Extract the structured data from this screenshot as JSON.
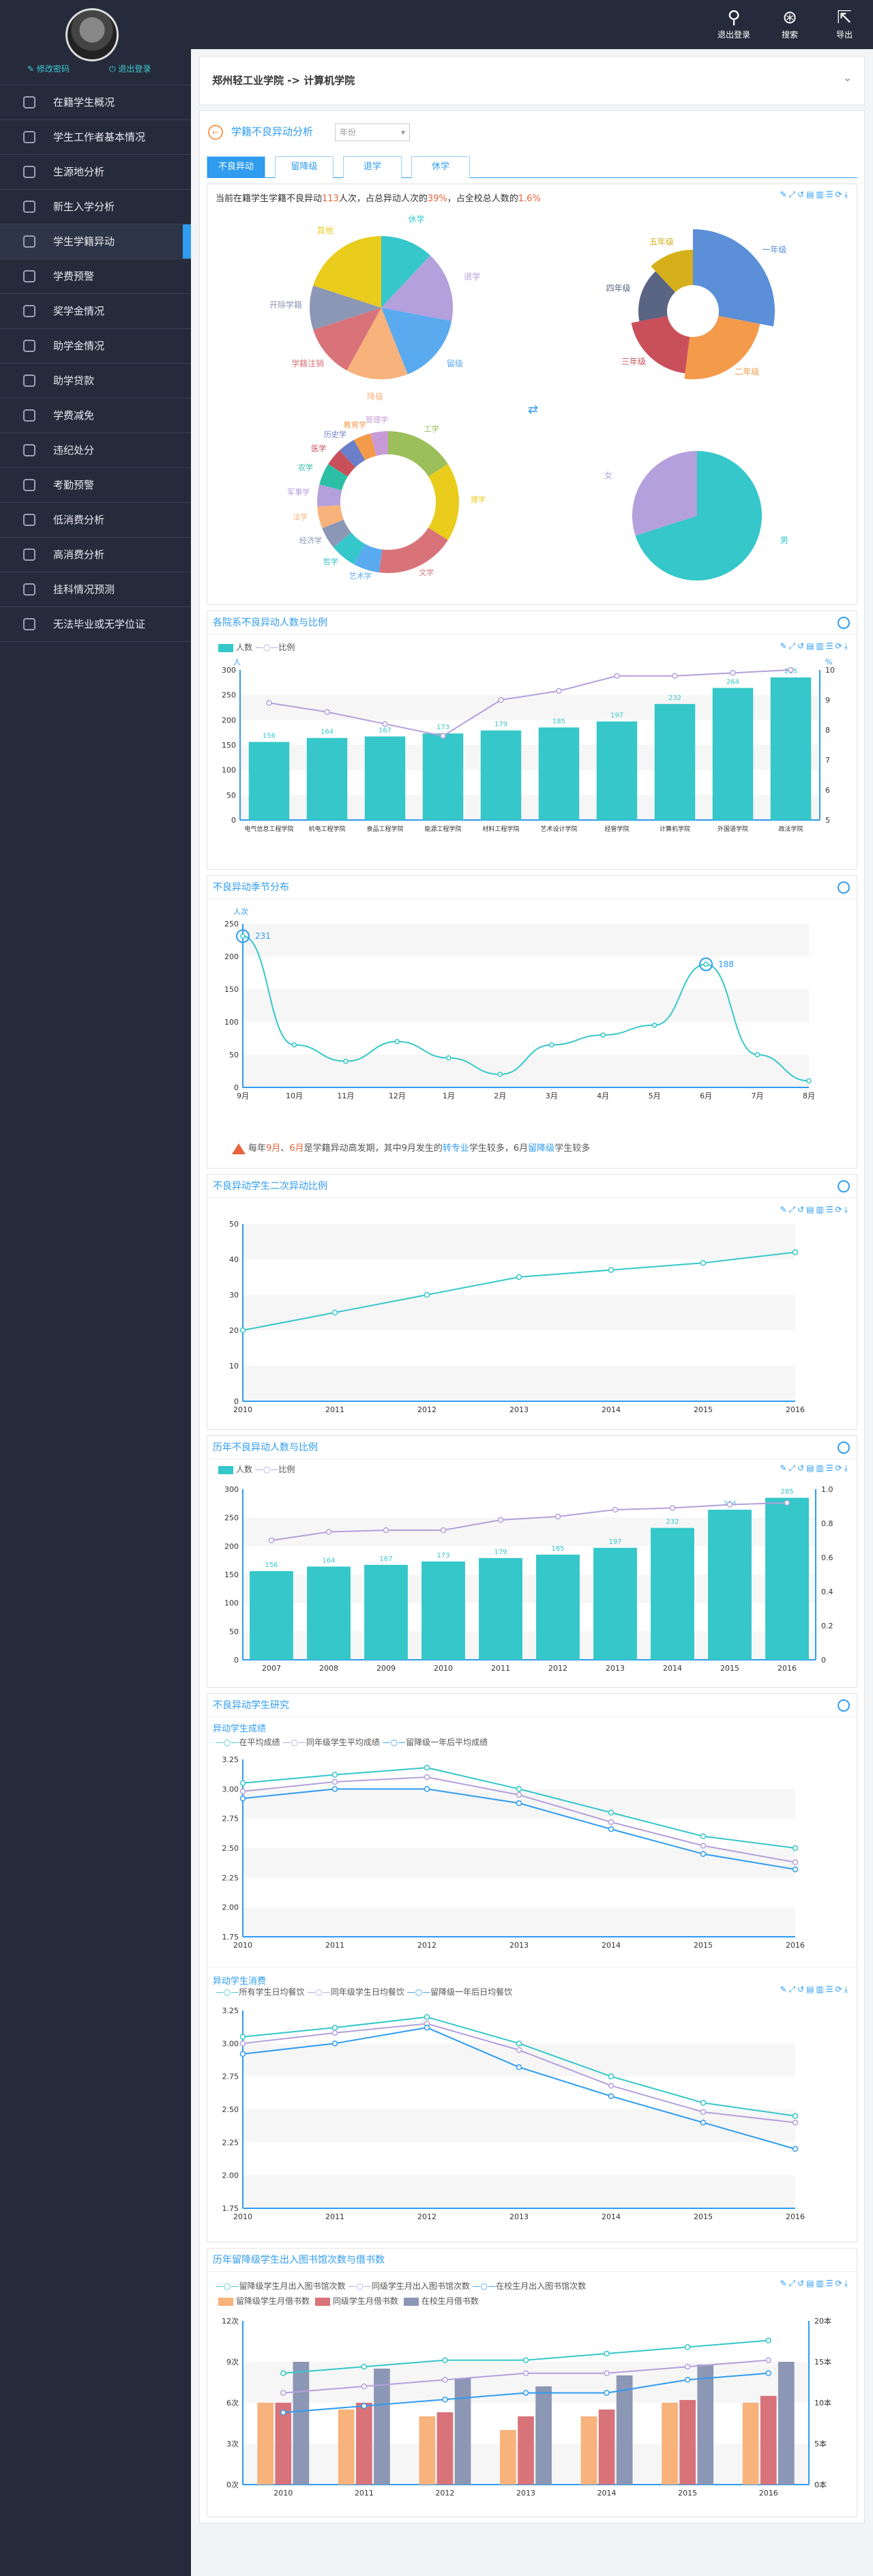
{
  "header": {
    "btn_logout": "退出登录",
    "btn_search": "搜索",
    "btn_export": "导出"
  },
  "sidebar": {
    "profile_edit": "修改密码",
    "profile_logout": "退出登录",
    "items": [
      {
        "label": "在籍学生概况"
      },
      {
        "label": "学生工作者基本情况"
      },
      {
        "label": "生源地分析"
      },
      {
        "label": "新生入学分析"
      },
      {
        "label": "学生学籍异动"
      },
      {
        "label": "学费预警"
      },
      {
        "label": "奖学金情况"
      },
      {
        "label": "助学金情况"
      },
      {
        "label": "助学贷款"
      },
      {
        "label": "学费减免"
      },
      {
        "label": "违纪处分"
      },
      {
        "label": "考勤预警"
      },
      {
        "label": "低消费分析"
      },
      {
        "label": "高消费分析"
      },
      {
        "label": "挂科情况预测"
      },
      {
        "label": "无法毕业或无学位证"
      }
    ],
    "active_index": 4
  },
  "breadcrumb": {
    "root": "郑州轻工业学院",
    "sep": "->",
    "current": "计算机学院"
  },
  "page": {
    "title": "学籍不良异动分析",
    "select_placeholder": "年份",
    "tabs": [
      "不良异动",
      "留降级",
      "退学",
      "休学"
    ],
    "summary_pre": "当前在籍学生学籍不良异动",
    "summary_n": "113",
    "summary_mid": "人次，占总异动人次的",
    "summary_p1": "39%",
    "summary_mid2": "，占全校总人数的",
    "summary_p2": "1.6%"
  },
  "colors": {
    "teal": "#35c7c9",
    "purple": "#b3a0dc",
    "blue": "#2f9cf0",
    "orange": "#e8643c"
  },
  "pies": {
    "pie1": {
      "labels": [
        "休学",
        "退学",
        "留级",
        "降级",
        "学籍注销",
        "开除学籍",
        "其他"
      ]
    },
    "pie2": {
      "labels": [
        "一年级",
        "二年级",
        "三年级",
        "四年级",
        "五年级"
      ]
    },
    "pie3": {
      "labels": [
        "工学",
        "理学",
        "文学",
        "艺术学",
        "哲学",
        "经济学",
        "法学",
        "军事学",
        "农学",
        "医学",
        "历史学",
        "教育学",
        "管理学"
      ]
    },
    "pie4": {
      "labels": [
        "男",
        "女"
      ]
    }
  },
  "sections": {
    "s1": "各院系不良异动人数与比例",
    "s2": "不良异动季节分布",
    "s3": "不良异动学生二次异动比例",
    "s4": "历年不良异动人数与比例",
    "s5": "不良异动学生研究",
    "s5a": "异动学生成绩",
    "s5b": "异动学生消费",
    "s6": "历年留降级学生出入图书馆次数与借书数"
  },
  "warning": {
    "pre": "每年",
    "m1": "9月",
    "sep": "、",
    "m2": "6月",
    "mid": "是学籍异动高发期，其中9月发生的",
    "t1": "转专业",
    "mid2": "学生较多，6月",
    "t2": "留降级",
    "post": "学生较多"
  },
  "chart_data": [
    {
      "type": "bar",
      "title": "各院系不良异动人数与比例",
      "series": [
        {
          "name": "人数",
          "values": [
            156,
            164,
            167,
            173,
            179,
            185,
            197,
            232,
            264,
            285
          ]
        },
        {
          "name": "比例",
          "values": [
            8.9,
            8.6,
            8.2,
            7.8,
            9.0,
            9.3,
            9.8,
            9.8,
            9.9,
            10
          ]
        }
      ],
      "categories": [
        "电气信息工程学院",
        "机电工程学院",
        "食品工程学院",
        "能源工程学院",
        "材料工程学院",
        "艺术设计学院",
        "经管学院",
        "计算机学院",
        "外国语学院",
        "政法学院"
      ],
      "ylabel": "人",
      "ylabel_right": "%",
      "ylim": [
        0,
        300
      ],
      "ylim_right": [
        5,
        10
      ],
      "yticks_right": [
        "5",
        "6",
        "7",
        "8",
        "9",
        "10"
      ]
    },
    {
      "type": "line",
      "title": "不良异动季节分布",
      "categories": [
        "9月",
        "10月",
        "11月",
        "12月",
        "1月",
        "2月",
        "3月",
        "4月",
        "5月",
        "6月",
        "7月",
        "8月"
      ],
      "values": [
        231,
        65,
        40,
        70,
        45,
        20,
        65,
        80,
        95,
        188,
        50,
        10
      ],
      "annotations": [
        "231",
        "188"
      ],
      "ylabel": "人次",
      "ylim": [
        0,
        250
      ]
    },
    {
      "type": "line",
      "title": "不良异动学生二次异动比例",
      "categories": [
        "2010",
        "2011",
        "2012",
        "2013",
        "2014",
        "2015",
        "2016"
      ],
      "values": [
        20,
        25,
        30,
        35,
        37,
        39,
        42
      ],
      "ylim": [
        0,
        50
      ]
    },
    {
      "type": "bar",
      "title": "历年不良异动人数与比例",
      "categories": [
        "2007",
        "2008",
        "2009",
        "2010",
        "2011",
        "2012",
        "2013",
        "2014",
        "2015",
        "2016"
      ],
      "series": [
        {
          "name": "人数",
          "values": [
            156,
            164,
            167,
            173,
            179,
            185,
            197,
            232,
            264,
            285
          ]
        },
        {
          "name": "比例",
          "values": [
            0.7,
            0.75,
            0.76,
            0.76,
            0.82,
            0.84,
            0.88,
            0.89,
            0.91,
            0.92
          ]
        }
      ],
      "ylim": [
        0,
        300
      ],
      "ylim_right": [
        0,
        1.0
      ],
      "yticks_right": [
        "0",
        "0.2",
        "0.4",
        "0.6",
        "0.8",
        "1.0"
      ]
    },
    {
      "type": "line",
      "title": "异动学生成绩",
      "categories": [
        "2010",
        "2011",
        "2012",
        "2013",
        "2014",
        "2015",
        "2016"
      ],
      "series": [
        {
          "name": "在平均成绩",
          "values": [
            3.05,
            3.12,
            3.18,
            3.0,
            2.8,
            2.6,
            2.5
          ]
        },
        {
          "name": "同年级学生平均成绩",
          "values": [
            2.98,
            3.06,
            3.1,
            2.95,
            2.72,
            2.52,
            2.38
          ]
        },
        {
          "name": "留降级一年后平均成绩",
          "values": [
            2.92,
            3.0,
            3.0,
            2.88,
            2.66,
            2.45,
            2.32
          ]
        }
      ],
      "ylim": [
        1.75,
        3.25
      ]
    },
    {
      "type": "line",
      "title": "异动学生消费",
      "categories": [
        "2010",
        "2011",
        "2012",
        "2013",
        "2014",
        "2015",
        "2016"
      ],
      "series": [
        {
          "name": "所有学生日均餐饮",
          "values": [
            3.05,
            3.12,
            3.2,
            3.0,
            2.75,
            2.55,
            2.45
          ]
        },
        {
          "name": "同年级学生日均餐饮",
          "values": [
            3.0,
            3.08,
            3.15,
            2.95,
            2.68,
            2.48,
            2.4
          ]
        },
        {
          "name": "留降级一年后日均餐饮",
          "values": [
            2.92,
            3.0,
            3.12,
            2.82,
            2.6,
            2.4,
            2.2
          ]
        }
      ],
      "ylim": [
        1.75,
        3.25
      ]
    },
    {
      "type": "bar",
      "title": "历年留降级学生出入图书馆次数与借书数",
      "categories": [
        "2010",
        "2011",
        "2012",
        "2013",
        "2014",
        "2015",
        "2016"
      ],
      "series": [
        {
          "name": "留降级学生月出入图书馆次数",
          "values": [
            17,
            18,
            19,
            19,
            20,
            21,
            22
          ]
        },
        {
          "name": "同级学生月出入图书馆次数",
          "values": [
            14,
            15,
            16,
            17,
            17,
            18,
            19
          ]
        },
        {
          "name": "在校生月出入图书馆次数",
          "values": [
            11,
            12,
            13,
            14,
            14,
            16,
            17
          ]
        },
        {
          "name": "留降级学生月借书数",
          "values": [
            6,
            5.5,
            5,
            4,
            5,
            6,
            6
          ]
        },
        {
          "name": "同级学生月借书数",
          "values": [
            6,
            6,
            5.3,
            5,
            5.5,
            6.2,
            6.5
          ]
        },
        {
          "name": "在校生月借书数",
          "values": [
            9,
            8.5,
            7.8,
            7.2,
            8,
            8.8,
            9
          ]
        }
      ],
      "ylim": [
        0,
        12
      ],
      "ylim_right": [
        0,
        25
      ],
      "yticks_left": [
        "0次",
        "3次",
        "6次",
        "9次",
        "12次"
      ],
      "yticks_right": [
        "0本",
        "5本",
        "10本",
        "15本",
        "20本"
      ]
    }
  ]
}
